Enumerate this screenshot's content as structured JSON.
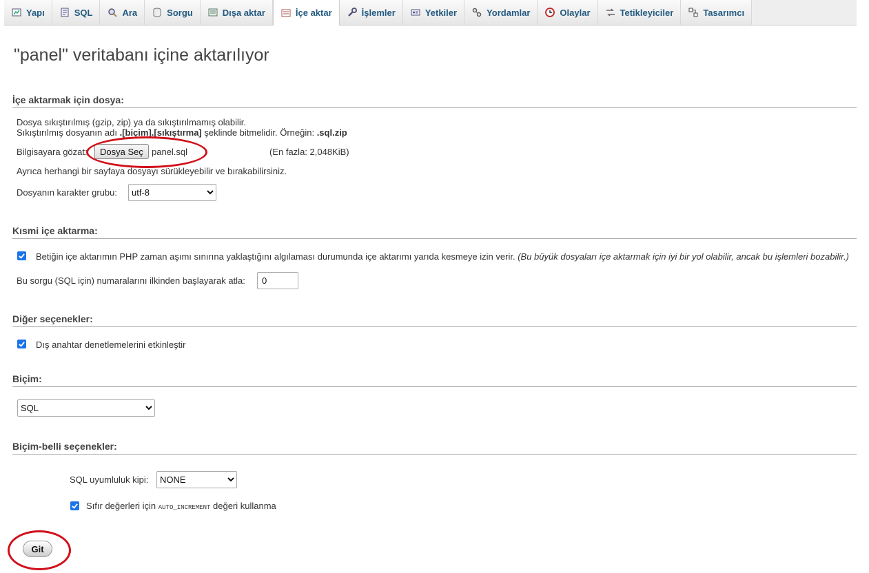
{
  "tabs": [
    {
      "label": "Yapı",
      "icon": "structure-icon"
    },
    {
      "label": "SQL",
      "icon": "sql-icon"
    },
    {
      "label": "Ara",
      "icon": "search-icon"
    },
    {
      "label": "Sorgu",
      "icon": "query-icon"
    },
    {
      "label": "Dışa aktar",
      "icon": "export-icon"
    },
    {
      "label": "İçe aktar",
      "icon": "import-icon",
      "active": true
    },
    {
      "label": "İşlemler",
      "icon": "wrench-icon"
    },
    {
      "label": "Yetkiler",
      "icon": "privileges-icon"
    },
    {
      "label": "Yordamlar",
      "icon": "routines-icon"
    },
    {
      "label": "Olaylar",
      "icon": "clock-icon"
    },
    {
      "label": "Tetikleyiciler",
      "icon": "triggers-icon"
    },
    {
      "label": "Tasarımcı",
      "icon": "designer-icon"
    }
  ],
  "page_title": "\"panel\" veritabanı içine aktarılıyor",
  "file_section": {
    "legend": "İçe aktarmak için dosya:",
    "line1": "Dosya sıkıştırılmış (gzip, zip) ya da sıkıştırılmamış olabilir.",
    "line2_prefix": "Sıkıştırılmış dosyanın adı ",
    "line2_bold": ".[biçim].[sıkıştırma]",
    "line2_mid": " şeklinde bitmelidir. Örneğin: ",
    "line2_example": ".sql.zip",
    "browse_label": "Bilgisayara gözat:",
    "choose_button": "Dosya Seç",
    "chosen_file": "panel.sql",
    "max_size": "(En fazla: 2,048KiB)",
    "drag_hint": "Ayrıca herhangi bir sayfaya dosyayı sürükleyebilir ve bırakabilirsiniz.",
    "charset_label": "Dosyanın karakter grubu:",
    "charset_value": "utf-8"
  },
  "partial_section": {
    "legend": "Kısmi içe aktarma:",
    "interrupt_label": "Betiğin içe aktarımın PHP zaman aşımı sınırına yaklaştığını algılaması durumunda içe aktarımı yarıda kesmeye izin verir.",
    "interrupt_note": "(Bu büyük dosyaları içe aktarmak için iyi bir yol olabilir, ancak bu işlemleri bozabilir.)",
    "interrupt_checked": true,
    "skip_label": "Bu sorgu (SQL için) numaralarını ilkinden başlayarak atla:",
    "skip_value": "0"
  },
  "other_section": {
    "legend": "Diğer seçenekler:",
    "fk_label": "Dış anahtar denetlemelerini etkinleştir",
    "fk_checked": true
  },
  "format_section": {
    "legend": "Biçim:",
    "format_value": "SQL"
  },
  "format_options": {
    "legend": "Biçim-belli seçenekler:",
    "compat_label": "SQL uyumluluk kipi:",
    "compat_value": "NONE",
    "autoinc_prefix": "Sıfır değerleri için ",
    "autoinc_code": "AUTO_INCREMENT",
    "autoinc_suffix": " değeri kullanma",
    "autoinc_checked": true
  },
  "go_button": "Git",
  "colors": {
    "tab_text": "#235a81",
    "checkbox": "#1a73e8",
    "highlight_ring": "#d0101a"
  }
}
